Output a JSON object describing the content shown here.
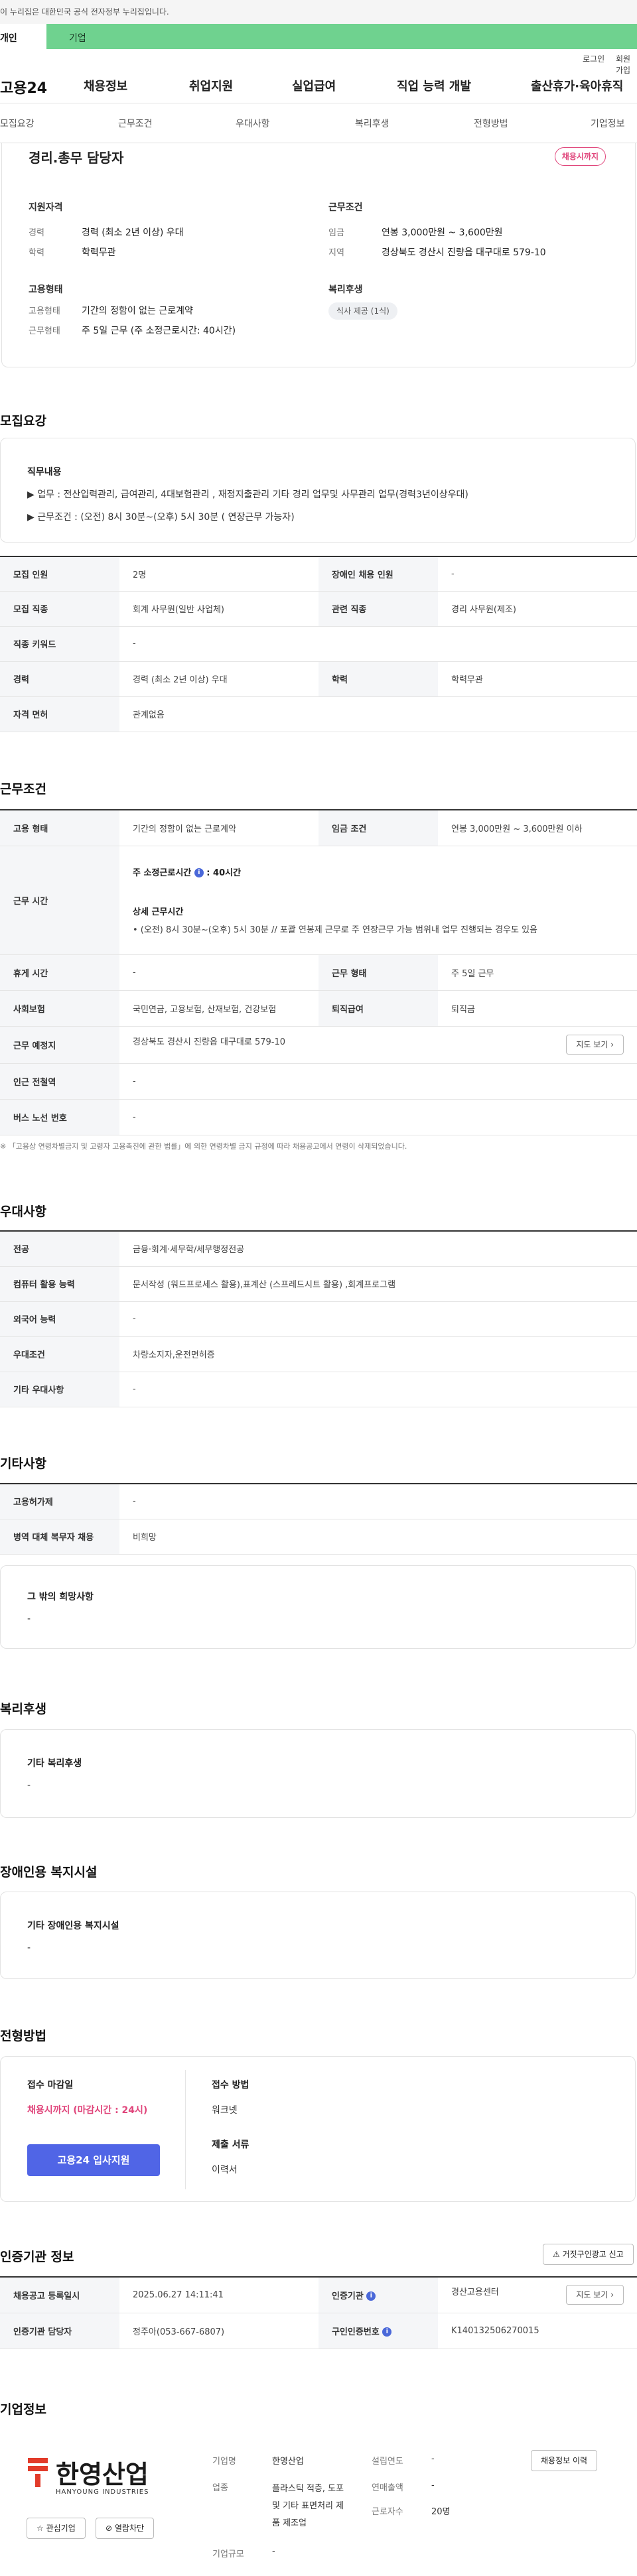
{
  "notice": "이 누리집은 대한민국 공식 전자정부 누리집입니다.",
  "tabs": {
    "individual": "개인",
    "company": "기업"
  },
  "util": {
    "login": "로그인",
    "join": "회원가입"
  },
  "gnb": {
    "logo": "고용24",
    "menu": [
      "채용정보",
      "취업지원",
      "실업급여",
      "직업 능력 개발",
      "출산휴가·육아휴직"
    ]
  },
  "snb": [
    "모집요강",
    "근무조건",
    "우대사항",
    "복리후생",
    "전형방법",
    "기업정보"
  ],
  "summary": {
    "title": "경리.총무 담당자",
    "badge": "채용시까지",
    "qual_head": "지원자격",
    "career_k": "경력",
    "career_v": "경력 (최소 2년 이상) 우대",
    "edu_k": "학력",
    "edu_v": "학력무관",
    "emp_head": "고용형태",
    "emptype_k": "고용형태",
    "emptype_v": "기간의 정함이 없는 근로계약",
    "worktype_k": "근무형태",
    "worktype_v": "주 5일 근무 (주 소정근로시간: 40시간)",
    "cond_head": "근무조건",
    "wage_k": "임금",
    "wage_v": "연봉 3,000만원 ~ 3,600만원",
    "area_k": "지역",
    "area_v": "경상북도 경산시 진량읍 대구대로 579-10",
    "welfare_head": "복리후생",
    "welfare_chip": "식사 제공 (1식)"
  },
  "recruit": {
    "title": "모집요강",
    "duty_label": "직무내용",
    "duty_line1": "▶ 업무 : 전산입력관리, 급여관리, 4대보험관리 , 재정지출관리  기타 경리 업무및 사무관리 업무(경력3년이상우대)",
    "duty_line2": "▶ 근무조건 : (오전) 8시 30분~(오후) 5시 30분 ( 연장근무 가능자)",
    "rows": [
      [
        "모집 인원",
        "2명",
        "장애인 채용 인원",
        "-"
      ],
      [
        "모집 직종",
        "회계 사무원(일반 사업체)",
        "관련 직종",
        "경리 사무원(제조)"
      ],
      [
        "직종 키워드",
        "-"
      ],
      [
        "경력",
        "경력 (최소 2년 이상) 우대",
        "학력",
        "학력무관"
      ],
      [
        "자격 면허",
        "관계없음"
      ]
    ]
  },
  "work": {
    "title": "근무조건",
    "emp_k": "고용 형태",
    "emp_v": "기간의 정함이 없는 근로계약",
    "wage_k": "임금 조건",
    "wage_v": "연봉 3,000만원 ~ 3,600만원 이하",
    "time_k": "근무 시간",
    "time_label": "주 소정근로시간",
    "time_hours": "40시간",
    "detail_label": "상세 근무시간",
    "detail_v": "• (오전) 8시 30분~(오후) 5시 30분  //  포괄 연봉제 근무로 주 연장근무 가능 범위내 업무 진행되는 경우도 있음",
    "rest_k": "휴게 시간",
    "rest_v": "-",
    "form_k": "근무 형태",
    "form_v": "주 5일 근무",
    "ins_k": "사회보험",
    "ins_v": "국민연금, 고용보험, 산재보험, 건강보험",
    "ret_k": "퇴직급여",
    "ret_v": "퇴직금",
    "place_k": "근무 예정지",
    "place_v": "경상북도 경산시 진량읍 대구대로 579-10",
    "map_btn": "지도 보기",
    "sub_k": "인근 전철역",
    "sub_v": "-",
    "bus_k": "버스 노선 번호",
    "bus_v": "-",
    "note": "※ 「고용상 연령차별금지 및 고령자 고용촉진에 관한 법률」에 의한 연령차별 금지 규정에 따라 채용공고에서 연령이 삭제되었습니다."
  },
  "pref": {
    "title": "우대사항",
    "rows": [
      [
        "전공",
        "금융·회계·세무학/세무행정전공"
      ],
      [
        "컴퓨터 활용 능력",
        "문서작성 (워드프로세스 활용),표계산 (스프레드시트 활용) ,회계프로그램"
      ],
      [
        "외국어 능력",
        "-"
      ],
      [
        "우대조건",
        "차량소지자,운전면허증"
      ],
      [
        "기타 우대사항",
        "-"
      ]
    ]
  },
  "etc": {
    "title": "기타사항",
    "rows": [
      [
        "고용허가제",
        "-"
      ],
      [
        "병역 대체 복무자 채용",
        "비희망"
      ]
    ],
    "other_label": "그 밖의 희망사항",
    "other_v": "-"
  },
  "welfare": {
    "title": "복리후생",
    "label": "기타 복리후생",
    "v": "-"
  },
  "disabled": {
    "title": "장애인용 복지시설",
    "label": "기타 장애인용 복지시설",
    "v": "-"
  },
  "selection": {
    "title": "전형방법",
    "deadline_label": "접수 마감일",
    "deadline_v": "채용시까지 (마감시간 : 24시)",
    "apply_btn": "고용24 입사지원",
    "method_label": "접수 방법",
    "method_v": "워크넷",
    "docs_label": "제출 서류",
    "docs_v": "이력서"
  },
  "agency": {
    "title": "인증기관 정보",
    "report_btn": "거짓구인광고 신고",
    "reg_k": "채용공고 등록일시",
    "reg_v": "2025.06.27 14:11:41",
    "agency_k": "인증기관",
    "agency_v": "경산고용센터",
    "map_btn": "지도 보기",
    "mgr_k": "인증기관 담당자",
    "mgr_v": "정주아(053-667-6807)",
    "num_k": "구인인증번호",
    "num_v": "K140132506270015"
  },
  "company": {
    "title": "기업정보",
    "logo_ko": "한영산업",
    "logo_en": "HANYOUNG INDUSTRIES",
    "fav_btn": "관심기업",
    "block_btn": "열람차단",
    "name_k": "기업명",
    "name_v": "한영산업",
    "biz_k": "업종",
    "biz_v": "플라스틱 적층, 도포 및 기타 표면처리 제품 제조업",
    "size_k": "기업규모",
    "size_v": "-",
    "est_k": "설립연도",
    "est_v": "-",
    "sales_k": "연매출액",
    "sales_v": "-",
    "emp_k": "근로자수",
    "emp_v": "20명",
    "history_btn": "채용정보 이력"
  },
  "colors": {
    "accent": "#5065e6",
    "green": "#6fd28f",
    "pink": "#e0457b"
  }
}
